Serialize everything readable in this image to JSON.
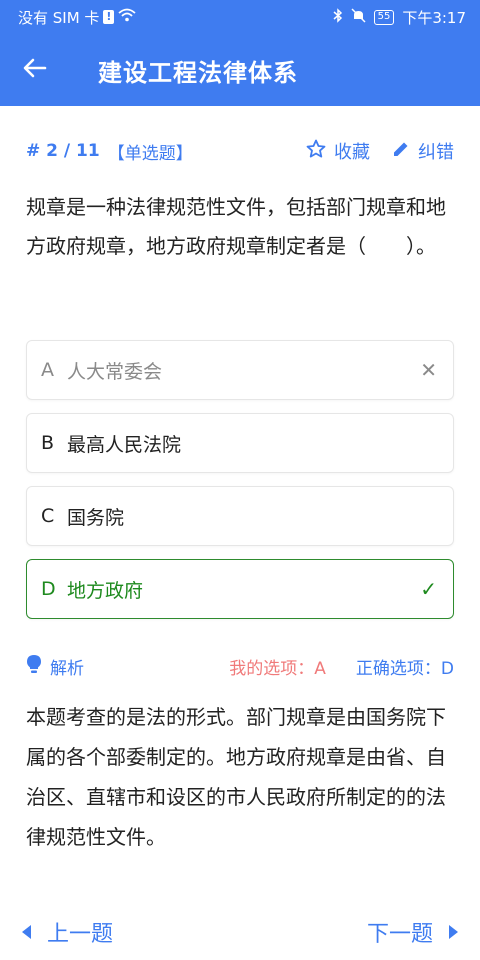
{
  "status_bar": {
    "carrier": "没有 SIM 卡",
    "sim_alert": "!",
    "battery": "55",
    "time": "下午3:17"
  },
  "app_bar": {
    "title": "建设工程法律体系",
    "back_icon": "arrow-left-icon"
  },
  "question_meta": {
    "progress": "# 2 / 11",
    "type": "【单选题】",
    "favorite_label": "收藏",
    "report_label": "纠错"
  },
  "question": {
    "text": "规章是一种法律规范性文件，包括部门规章和地方政府规章，地方政府规章制定者是（　　）。"
  },
  "options": [
    {
      "letter": "A",
      "text": "人大常委会",
      "state": "wrong",
      "mark": "✕"
    },
    {
      "letter": "B",
      "text": "最高人民法院",
      "state": "normal",
      "mark": ""
    },
    {
      "letter": "C",
      "text": "国务院",
      "state": "normal",
      "mark": ""
    },
    {
      "letter": "D",
      "text": "地方政府",
      "state": "correct",
      "mark": "✓"
    }
  ],
  "analysis": {
    "label": "解析",
    "my_choice": "我的选项：A",
    "correct_choice": "正确选项：D",
    "text": "本题考查的是法的形式。部门规章是由国务院下属的各个部委制定的。地方政府规章是由省、自治区、直辖市和设区的市人民政府所制定的的法律规范性文件。"
  },
  "navigation": {
    "prev_label": "上一题",
    "next_label": "下一题"
  },
  "colors": {
    "primary": "#3f7cf0",
    "correct": "#1e8a1e",
    "wrong_text": "#8a8a8a",
    "my_choice": "#f07a7a"
  }
}
